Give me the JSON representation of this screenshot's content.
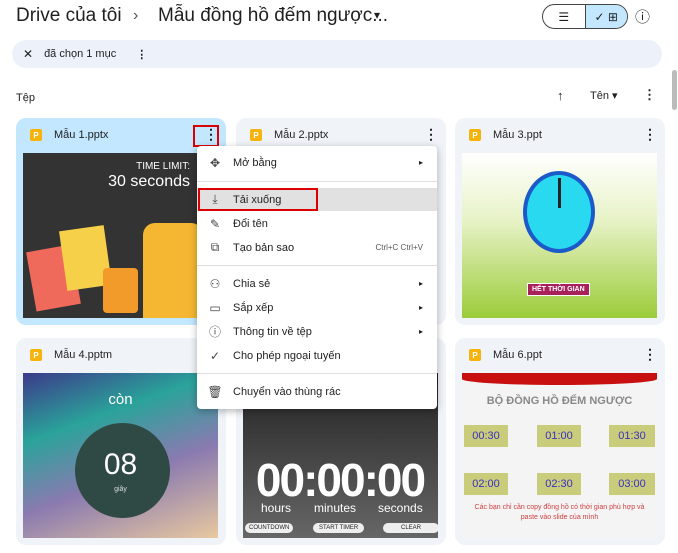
{
  "header": {
    "root": "Drive của tôi",
    "separator": "›",
    "folder": "Mẫu đồng hồ đếm ngược...",
    "dropdown_icon": "▾",
    "list_icon": "☰",
    "grid_icon": "✓ ⊞",
    "info_icon": "ⓘ"
  },
  "selection": {
    "close_icon": "✕",
    "label": "đã chọn 1 mục",
    "more_icon": "⋮"
  },
  "section": {
    "title": "Tệp",
    "sort_icon": "↑",
    "sort_label": "Tên ▾",
    "more_icon": "⋮"
  },
  "files": [
    {
      "name": "Mẫu 1.pptx",
      "thumb": {
        "line1": "TIME LIMIT:",
        "line2": "30 seconds"
      }
    },
    {
      "name": "Mẫu 2.pptx"
    },
    {
      "name": "Mẫu 3.ppt",
      "thumb": {
        "banner": "HẾT THỜI GIAN"
      }
    },
    {
      "name": "Mẫu 4.pptm",
      "thumb": {
        "top": "còn",
        "number": "08",
        "unit": "giây"
      }
    },
    {
      "name": "",
      "thumb": {
        "time": "00:00:00",
        "labels": [
          "hours",
          "minutes",
          "seconds"
        ],
        "buttons": [
          "COUNTDOWN",
          "START TIMER",
          "CLEAR"
        ]
      }
    },
    {
      "name": "Mẫu 6.ppt",
      "thumb": {
        "title": "BỘ ĐỒNG HỒ ĐẾM NGƯỢC",
        "times": [
          "00:30",
          "01:00",
          "01:30",
          "02:00",
          "02:30",
          "03:00"
        ],
        "note": "Các bạn chỉ cần copy đồng hồ có thời gian phù hợp và paste vào slide của mình"
      }
    }
  ],
  "file_icon_letter": "P",
  "kebab": "⋮",
  "menu": [
    {
      "label": "Mở bằng",
      "icon": "✥",
      "submenu": "▸"
    },
    {
      "label": "Tải xuống",
      "icon": "⤓"
    },
    {
      "label": "Đổi tên",
      "icon": "✎"
    },
    {
      "label": "Tạo bản sao",
      "icon": "⧉",
      "shortcut": "Ctrl+C Ctrl+V"
    },
    {
      "label": "Chia sẻ",
      "icon": "⚇",
      "submenu": "▸"
    },
    {
      "label": "Sắp xếp",
      "icon": "▭",
      "submenu": "▸"
    },
    {
      "label": "Thông tin về tệp",
      "icon": "ⓘ",
      "submenu": "▸"
    },
    {
      "label": "Cho phép ngoại tuyến",
      "icon": "✓"
    },
    {
      "label": "Chuyển vào thùng rác",
      "icon": "🗑"
    }
  ]
}
